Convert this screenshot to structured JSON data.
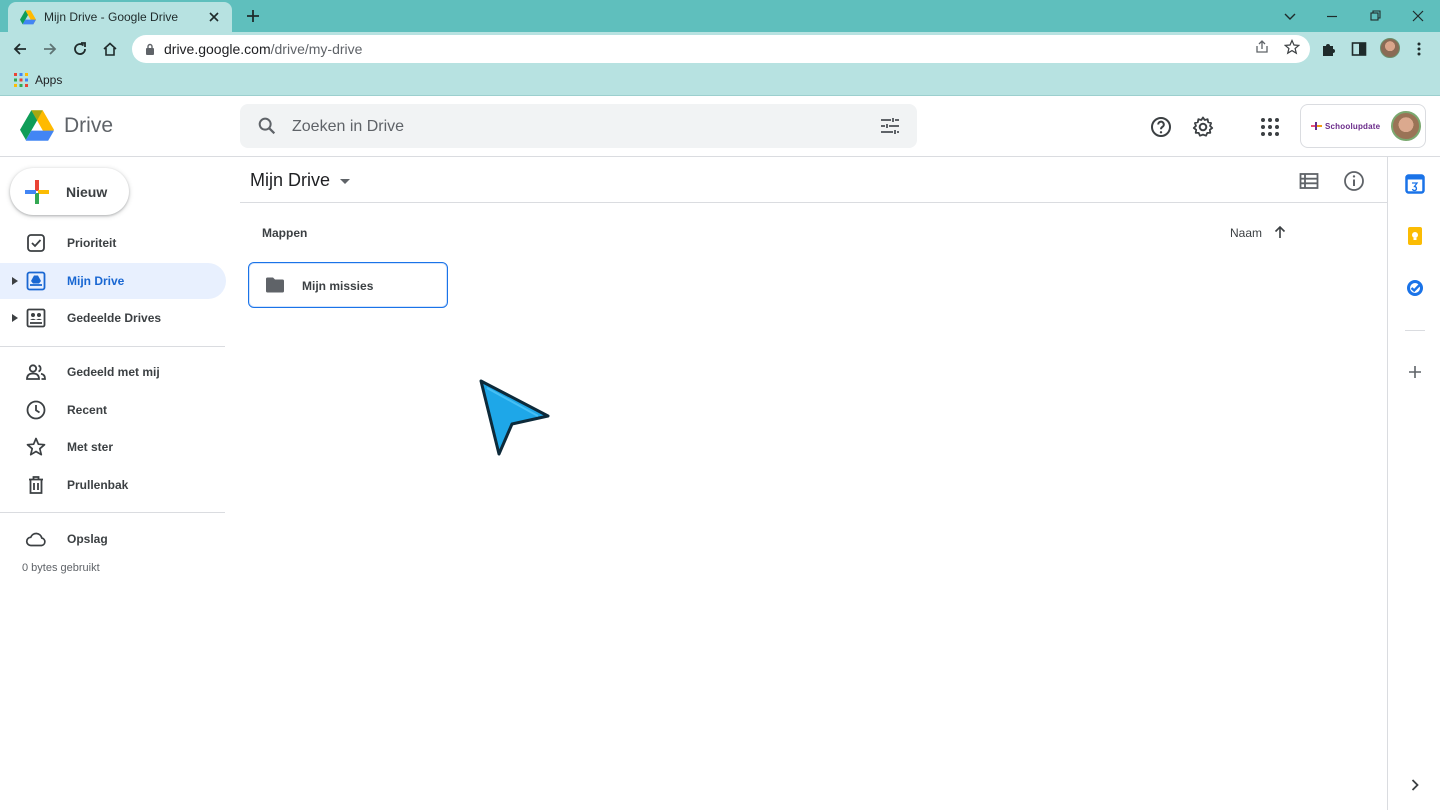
{
  "browser": {
    "tab_title": "Mijn Drive - Google Drive",
    "url_host": "drive.google.com",
    "url_path": "/drive/my-drive",
    "bookmark_apps_label": "Apps"
  },
  "header": {
    "product_name": "Drive",
    "search_placeholder": "Zoeken in Drive",
    "org_name": "Schoolupdate"
  },
  "sidebar": {
    "new_button_label": "Nieuw",
    "items": [
      {
        "label": "Prioriteit",
        "icon": "check-box-icon"
      },
      {
        "label": "Mijn Drive",
        "icon": "my-drive-icon"
      },
      {
        "label": "Gedeelde Drives",
        "icon": "shared-drives-icon"
      },
      {
        "label": "Gedeeld met mij",
        "icon": "people-icon"
      },
      {
        "label": "Recent",
        "icon": "clock-icon"
      },
      {
        "label": "Met ster",
        "icon": "star-icon"
      },
      {
        "label": "Prullenbak",
        "icon": "trash-icon"
      },
      {
        "label": "Opslag",
        "icon": "cloud-icon"
      }
    ],
    "storage_used": "0 bytes gebruikt"
  },
  "main": {
    "breadcrumb_title": "Mijn Drive",
    "section_label": "Mappen",
    "sort_label": "Naam",
    "folders": [
      {
        "name": "Mijn missies"
      }
    ]
  },
  "colors": {
    "browser_frame": "#5fbfbd",
    "browser_toolbar": "#b7e2e1",
    "active_nav_bg": "#e8f0fe",
    "active_nav_text": "#1967d2",
    "selection_border": "#1a73e8",
    "cursor_fill": "#1ea7e8"
  }
}
